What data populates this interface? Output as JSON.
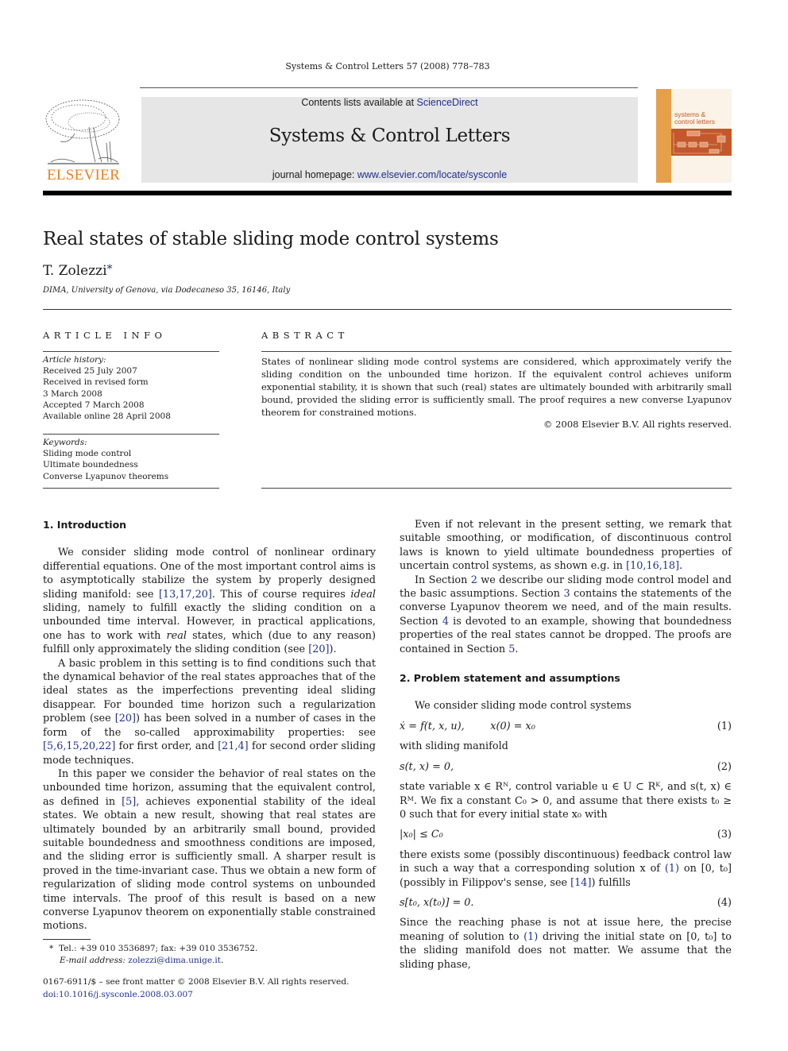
{
  "running_head": "Systems & Control Letters 57 (2008) 778–783",
  "banner": {
    "contents_prefix": "Contents lists available at ",
    "contents_link": "ScienceDirect",
    "journal_title": "Systems & Control Letters",
    "homepage_prefix": "journal homepage: ",
    "homepage_link": "www.elsevier.com/locate/sysconle"
  },
  "publisher_logo": {
    "wordmark": "ELSEVIER",
    "color": "#f07f1c"
  },
  "cover": {
    "title_line1": "systems &",
    "title_line2": "control letters"
  },
  "article": {
    "title": "Real states of stable sliding mode control systems",
    "author": "T. Zolezzi",
    "author_mark": "*",
    "affiliation": "DIMA, University of Genova, via Dodecaneso 35, 16146, Italy"
  },
  "article_info": {
    "label": "ARTICLE INFO",
    "history_label": "Article history:",
    "history": [
      "Received 25 July 2007",
      "Received in revised form",
      "3 March 2008",
      "Accepted 7 March 2008",
      "Available online 28 April 2008"
    ],
    "keywords_label": "Keywords:",
    "keywords": [
      "Sliding mode control",
      "Ultimate boundedness",
      "Converse Lyapunov theorems"
    ]
  },
  "abstract": {
    "label": "ABSTRACT",
    "text": "States of nonlinear sliding mode control systems are considered, which approximately verify the sliding condition on the unbounded time horizon. If the equivalent control achieves uniform exponential stability, it is shown that such (real) states are ultimately bounded with arbitrarily small bound, provided the sliding error is sufficiently small. The proof requires a new converse Lyapunov theorem for constrained motions.",
    "copyright": "© 2008 Elsevier B.V. All rights reserved."
  },
  "section1": {
    "heading": "1.  Introduction",
    "p1": [
      "We consider sliding mode control of nonlinear ordinary differential equations. One of the most important control aims is to asymptotically stabilize the system by properly designed sliding manifold: see ",
      "[13,17,20]",
      ". This of course requires ",
      "ideal",
      " sliding, namely to fulfill exactly the sliding condition on a unbounded time interval. However, in practical applications, one has to work with ",
      "real",
      " states, which (due to any reason) fulfill only approximately the sliding condition (see ",
      "[20]",
      ")."
    ],
    "p2": [
      "A basic problem in this setting is to find conditions such that the dynamical behavior of the real states approaches that of the ideal states as the imperfections preventing ideal sliding disappear. For bounded time horizon such a regularization problem (see ",
      "[20]",
      ") has been solved in a number of cases in the form of the so-called approximability properties: see ",
      "[5,6,15,20,22]",
      " for first order, and ",
      "[21,4]",
      " for second order sliding mode techniques."
    ],
    "p3": [
      "In this paper we consider the behavior of real states on the unbounded time horizon, assuming that the equivalent control, as defined in ",
      "[5]",
      ", achieves exponential stability of the ideal states. We obtain a new result, showing that real states are ultimately bounded by an arbitrarily small bound, provided suitable boundedness and smoothness conditions are imposed, and the sliding error is sufficiently small. A sharper result is proved in the time-invariant case. Thus we obtain a new form of regularization of sliding mode control systems on unbounded time intervals. The proof of this result is based on a new converse Lyapunov theorem on exponentially stable constrained motions."
    ],
    "p4": [
      "Even if not relevant in the present setting, we remark that suitable smoothing, or modification, of discontinuous control laws is known to yield ultimate boundedness properties of uncertain control systems, as shown e.g. in ",
      "[10,16,18]",
      "."
    ],
    "p5": [
      "In Section ",
      "2",
      " we describe our sliding mode control model and the basic assumptions. Section ",
      "3",
      " contains the statements of the converse Lyapunov theorem we need, and of the main results. Section ",
      "4",
      " is devoted to an example, showing that boundedness properties of the real states cannot be dropped. The proofs are contained in Section ",
      "5",
      "."
    ]
  },
  "section2": {
    "heading": "2.  Problem statement and assumptions",
    "intro": "We consider sliding mode control systems",
    "eq1": "ẋ = f(t, x, u),        x(0) = x₀",
    "eq1_num": "(1)",
    "after_eq1": "with sliding manifold",
    "eq2": "s(t, x) = 0,",
    "eq2_num": "(2)",
    "p_state": "state variable x ∈ Rᴺ, control variable u ∈ U ⊂ Rᴷ, and s(t, x) ∈ Rᴹ. We fix a constant C₀ > 0, and assume that there exists t₀ ≥ 0 such that for every initial state x₀ with",
    "eq3": "|x₀| ≤ C₀",
    "eq3_num": "(3)",
    "p_after3": [
      "there exists some (possibly discontinuous) feedback control law in such a way that a corresponding solution x of ",
      "(1)",
      " on [0, t₀] (possibly in Filippov's sense, see ",
      "[14]",
      ") fulfills"
    ],
    "eq4": "s[t₀, x(t₀)] = 0.",
    "eq4_num": "(4)",
    "p_after4": [
      "Since the reaching phase is not at issue here, the precise meaning of solution to ",
      "(1)",
      " driving the initial state on [0, t₀] to the sliding manifold does not matter. We assume that the sliding phase,"
    ]
  },
  "footnote": {
    "mark": "*",
    "contact": "Tel.: +39 010 3536897; fax: +39 010 3536752.",
    "email_label": "E-mail address: ",
    "email": "zolezzi@dima.unige.it",
    "email_end": "."
  },
  "footer": {
    "issn_line": "0167-6911/$ – see front matter © 2008 Elsevier B.V. All rights reserved.",
    "doi": "doi:10.1016/j.sysconle.2008.03.007"
  }
}
